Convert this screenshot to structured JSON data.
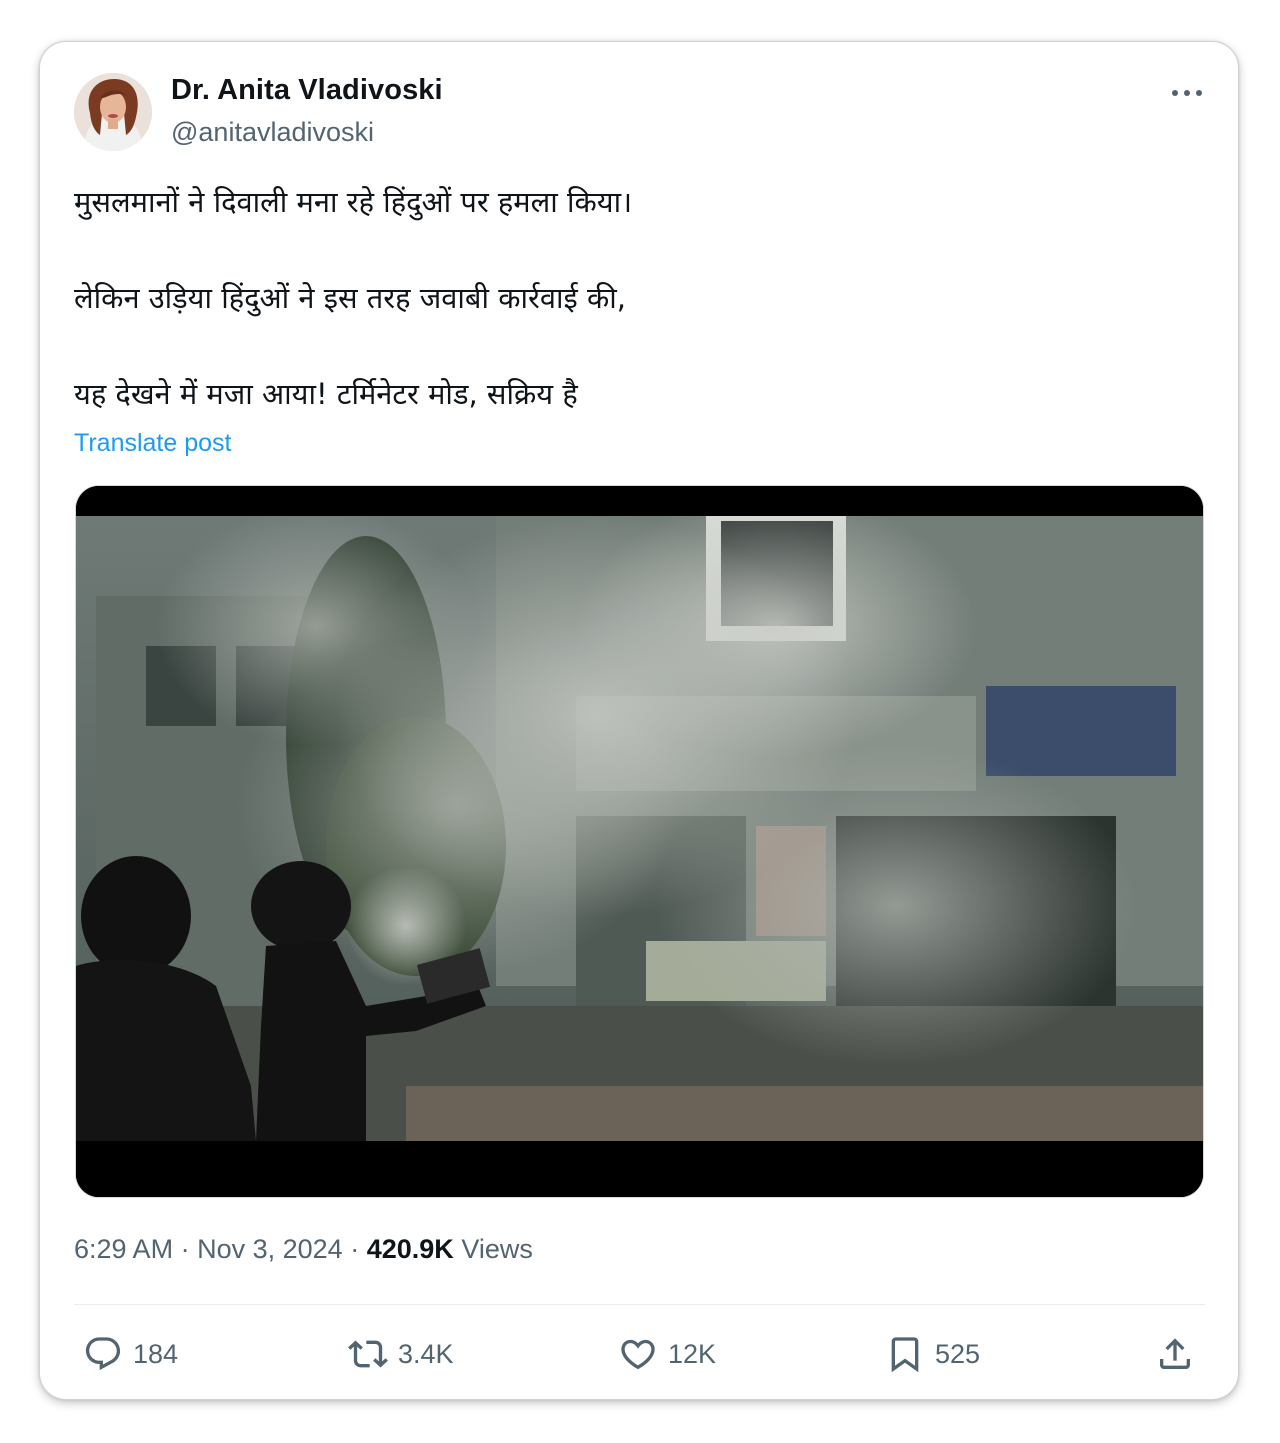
{
  "author": {
    "display_name": "Dr. Anita Vladivoski",
    "handle": "@anitavladivoski"
  },
  "post": {
    "lines": [
      "मुसलमानों ने दिवाली मना रहे हिंदुओं पर हमला किया।",
      "लेकिन उड़िया हिंदुओं ने इस तरह जवाबी कार्रवाई की,",
      "यह देखने में मजा आया! टर्मिनेटर मोड, सक्रिय है"
    ],
    "translate_label": "Translate post"
  },
  "meta": {
    "time": "6:29 AM",
    "separator": "·",
    "date": "Nov 3, 2024",
    "views_count": "420.9K",
    "views_label": "Views"
  },
  "actions": {
    "replies": "184",
    "reposts": "3.4K",
    "likes": "12K",
    "bookmarks": "525"
  },
  "icons": {
    "more": "more-horizontal-icon",
    "reply": "reply-icon",
    "repost": "repost-icon",
    "like": "heart-icon",
    "bookmark": "bookmark-icon",
    "share": "share-icon"
  },
  "colors": {
    "link": "#1d9bf0",
    "text": "#0f1419",
    "secondary": "#536471"
  }
}
